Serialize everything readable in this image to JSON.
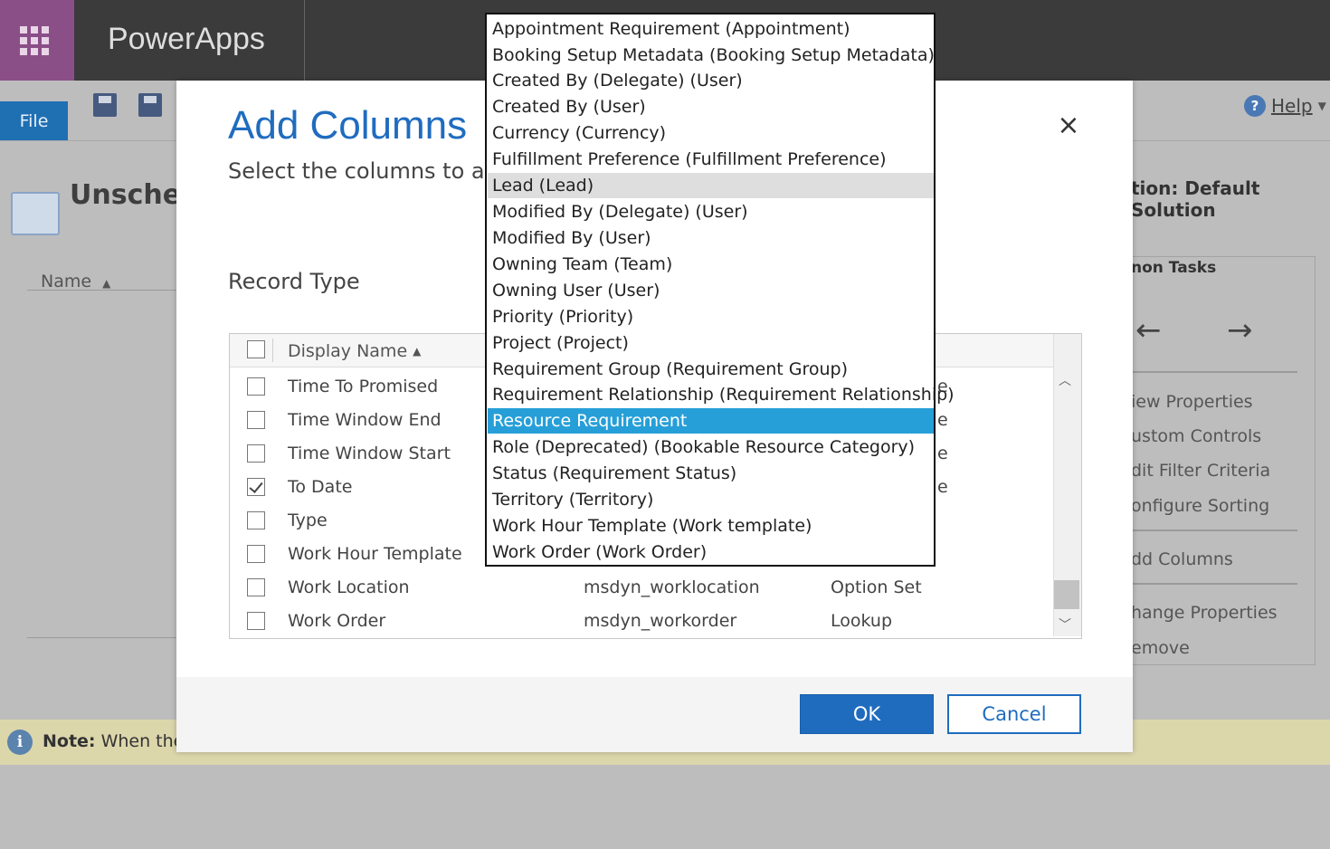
{
  "app": {
    "brand": "PowerApps"
  },
  "ribbon": {
    "file_label": "File",
    "help_label": "Help",
    "help_icon": "?"
  },
  "page": {
    "title": "Unsche",
    "name_column": "Name",
    "solution_label": "tion: Default Solution"
  },
  "common_tasks": {
    "title": "non Tasks",
    "back_glyph": "←",
    "forward_glyph": "→",
    "items": [
      "iew Properties",
      "ustom Controls",
      "dit Filter Criteria",
      "onfigure Sorting",
      "dd Columns",
      "hange Properties",
      "emove"
    ]
  },
  "note": {
    "icon": "i",
    "bold": "Note:",
    "text": "When the"
  },
  "dialog": {
    "title": "Add Columns",
    "subtitle": "Select the columns to ade",
    "close_glyph": "×",
    "record_type_label": "Record Type",
    "grid": {
      "header_display_name": "Display Name",
      "sort_glyph": "▲",
      "rows": [
        {
          "display": "Time To Promised",
          "schema": "",
          "type": "",
          "trail": "e",
          "checked": false
        },
        {
          "display": "Time Window End",
          "schema": "",
          "type": "",
          "trail": "e",
          "checked": false
        },
        {
          "display": "Time Window Start",
          "schema": "",
          "type": "",
          "trail": "e",
          "checked": false
        },
        {
          "display": "To Date",
          "schema": "",
          "type": "",
          "trail": "e",
          "checked": true
        },
        {
          "display": "Type",
          "schema": "",
          "type": "",
          "trail": "",
          "checked": false
        },
        {
          "display": "Work Hour Template",
          "schema": "",
          "type": "",
          "trail": "",
          "checked": false
        },
        {
          "display": "Work Location",
          "schema": "msdyn_worklocation",
          "type": "Option Set",
          "trail": "",
          "checked": false
        },
        {
          "display": "Work Order",
          "schema": "msdyn_workorder",
          "type": "Lookup",
          "trail": "",
          "checked": false
        }
      ]
    },
    "ok_label": "OK",
    "cancel_label": "Cancel"
  },
  "dropdown": {
    "hover_item": "Lead (Lead)",
    "selected_item": "Resource Requirement",
    "options": [
      "Appointment Requirement (Appointment)",
      "Booking Setup Metadata (Booking Setup Metadata)",
      "Created By (Delegate) (User)",
      "Created By (User)",
      "Currency (Currency)",
      "Fulfillment Preference (Fulfillment Preference)",
      "Lead (Lead)",
      "Modified By (Delegate) (User)",
      "Modified By (User)",
      "Owning Team (Team)",
      "Owning User (User)",
      "Priority (Priority)",
      "Project (Project)",
      "Requirement Group (Requirement Group)",
      "Requirement Relationship (Requirement Relationship)",
      "Resource Requirement",
      "Role (Deprecated) (Bookable Resource Category)",
      "Status (Requirement Status)",
      "Territory (Territory)",
      "Work Hour Template (Work template)",
      "Work Order (Work Order)"
    ]
  },
  "colors": {
    "accent": "#1f6cbf",
    "selected": "#269fd8",
    "waffle": "#8b4f88",
    "topbar": "#3b3b3b"
  }
}
